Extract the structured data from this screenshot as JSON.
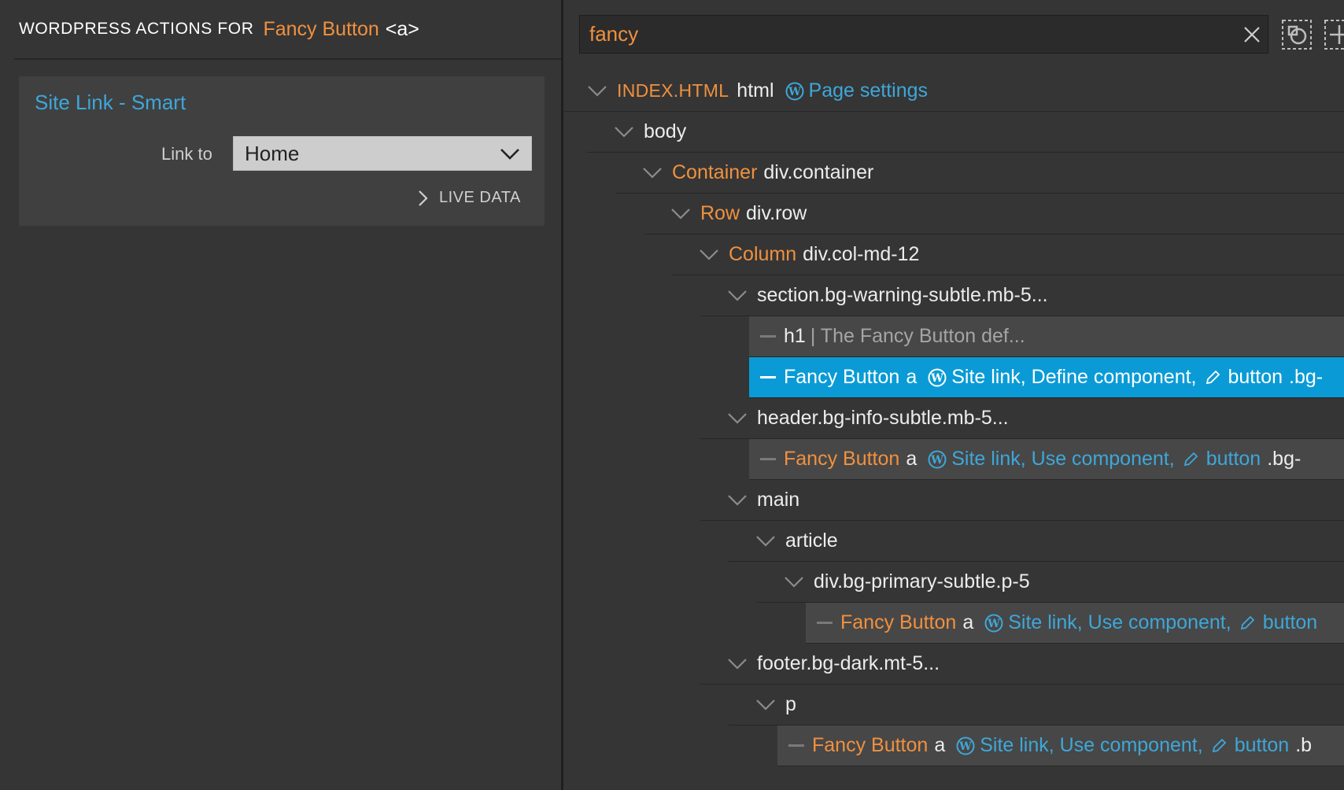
{
  "left": {
    "header_prefix": "WORDPRESS ACTIONS FOR",
    "header_name": "Fancy Button",
    "header_tag": "<a>",
    "card_title": "Site Link - Smart",
    "link_label": "Link to",
    "link_value": "Home",
    "live_data": "LIVE DATA"
  },
  "search": {
    "value": "fancy"
  },
  "tree": {
    "root_file": "INDEX.HTML",
    "root_tag": "html",
    "root_action": "Page settings",
    "body": "body",
    "container_name": "Container",
    "container_tag": "div.container",
    "row_name": "Row",
    "row_tag": "div.row",
    "col_name": "Column",
    "col_tag": "div.col-md-12",
    "section_tag": "section.bg-warning-subtle.mb-5...",
    "h1_tag": "h1",
    "h1_text": "| The Fancy Button def...",
    "sel_name": "Fancy Button",
    "sel_tag": "a",
    "sel_actions": "Site link, Define component,",
    "sel_action2": "button",
    "sel_class": ".bg-",
    "header_tag": "header.bg-info-subtle.mb-5...",
    "fb2_name": "Fancy Button",
    "fb2_tag": "a",
    "fb2_actions": "Site link, Use component,",
    "fb2_action2": "button",
    "fb2_class": ".bg-",
    "main_tag": "main",
    "article_tag": "article",
    "div_tag": "div.bg-primary-subtle.p-5",
    "fb3_name": "Fancy Button",
    "fb3_tag": "a",
    "fb3_actions": "Site link, Use component,",
    "fb3_action2": "button",
    "footer_tag": "footer.bg-dark.mt-5...",
    "p_tag": "p",
    "fb4_name": "Fancy Button",
    "fb4_tag": "a",
    "fb4_actions": "Site link, Use component,",
    "fb4_action2": "button",
    "fb4_class": ".b"
  },
  "colors": {
    "orange": "#f0913f",
    "blue": "#3ea7d9",
    "selected": "#0a9bd6"
  }
}
